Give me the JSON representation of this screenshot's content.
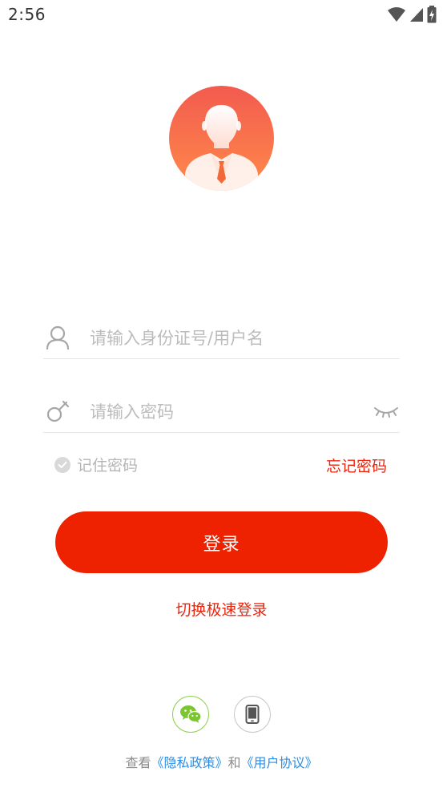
{
  "status_bar": {
    "time": "2:56",
    "icons": [
      "wifi-icon",
      "cellular-signal-icon",
      "battery-charging-icon"
    ]
  },
  "avatar": {
    "icon": "user-avatar-icon",
    "gradient_top": "#f25b4f",
    "gradient_bottom": "#ff8a4a"
  },
  "form": {
    "username": {
      "icon": "user-outline-icon",
      "placeholder": "请输入身份证号/用户名",
      "value": ""
    },
    "password": {
      "icon": "key-icon",
      "placeholder": "请输入密码",
      "value": "",
      "toggle_icon": "eye-closed-icon"
    },
    "remember_label": "记住密码",
    "forgot_label": "忘记密码"
  },
  "login_button_label": "登录",
  "switch_login_label": "切换极速登录",
  "third_party": [
    {
      "name": "wechat-login",
      "icon": "wechat-icon",
      "color": "#7bc62f"
    },
    {
      "name": "phone-login",
      "icon": "mobile-phone-icon",
      "color": "#555555"
    }
  ],
  "agreement": {
    "prefix": "查看",
    "privacy_link": "《隐私政策》",
    "conjunction": "和",
    "user_agreement_link": "《用户协议》"
  },
  "colors": {
    "accent": "#ee2200",
    "link_blue": "#2a8de6",
    "placeholder": "#bcbcbc"
  }
}
